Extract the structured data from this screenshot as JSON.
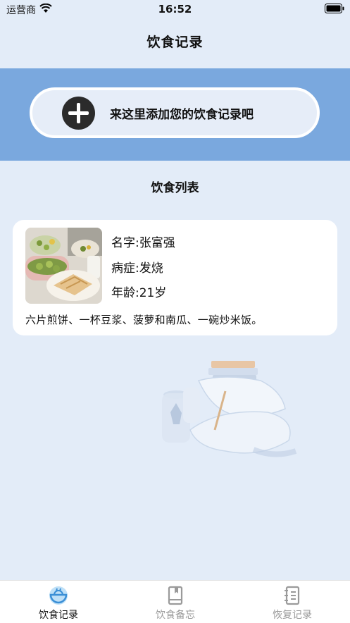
{
  "status": {
    "carrier": "运营商",
    "time": "16:52"
  },
  "header": {
    "title": "饮食记录"
  },
  "add_entry": {
    "label": "来这里添加您的饮食记录吧"
  },
  "list": {
    "title": "饮食列表",
    "records": [
      {
        "name": "名字:张富强",
        "symptom": "病症:发烧",
        "age": "年龄:21岁",
        "description": "六片煎饼、一杯豆浆、菠萝和南瓜、一碗炒米饭。"
      }
    ]
  },
  "tabs": [
    {
      "label": "饮食记录",
      "icon": "bowl-icon",
      "active": true
    },
    {
      "label": "饮食备忘",
      "icon": "book-icon",
      "active": false
    },
    {
      "label": "恢复记录",
      "icon": "notes-icon",
      "active": false
    }
  ],
  "colors": {
    "background": "#e3ecf8",
    "band": "#7aa8de",
    "accent": "#3b8fd6",
    "inactive": "#9a9a9a"
  }
}
